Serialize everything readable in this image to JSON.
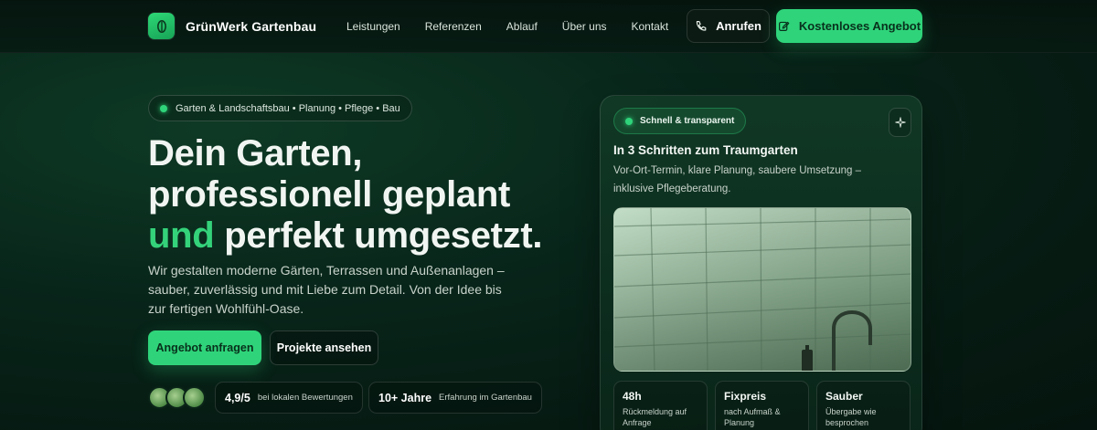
{
  "nav": {
    "brand": "GrünWerk Gartenbau",
    "links": [
      "Leistungen",
      "Referenzen",
      "Ablauf",
      "Über uns",
      "Kontakt"
    ],
    "call_label": "Anrufen",
    "offer_label": "Kostenloses Angebot"
  },
  "hero": {
    "tag": "Garten & Landschaftsbau • Planung • Pflege • Bau",
    "headline_line1": "Dein Garten,",
    "headline_line2": "professionell geplant",
    "headline_accent": "und",
    "headline_line3": " perfekt umgesetzt.",
    "subtext": "Wir gestalten moderne Gärten, Terrassen und Außenanlagen – sauber, zuverlässig und mit Liebe zum Detail. Von der Idee bis zur fertigen Wohlfühl-Oase.",
    "cta_primary": "Angebot anfragen",
    "cta_secondary": "Projekte ansehen",
    "rating_value": "4,9/5",
    "rating_label": "bei lokalen Bewertungen",
    "experience_value": "10+ Jahre",
    "experience_label": "Erfahrung im Gartenbau"
  },
  "card": {
    "badge": "Schnell & transparent",
    "title": "In 3 Schritten zum Traumgarten",
    "text": "Vor-Ort-Termin, klare Planung, saubere Umsetzung – inklusive Pflegeberatung.",
    "features": [
      {
        "title": "48h",
        "desc": "Rückmeldung auf Anfrage"
      },
      {
        "title": "Fixpreis",
        "desc": "nach Aufmaß & Planung"
      },
      {
        "title": "Sauber",
        "desc": "Übergabe wie besprochen"
      }
    ]
  },
  "colors": {
    "accent": "#2fd47a",
    "background": "#061a12"
  }
}
